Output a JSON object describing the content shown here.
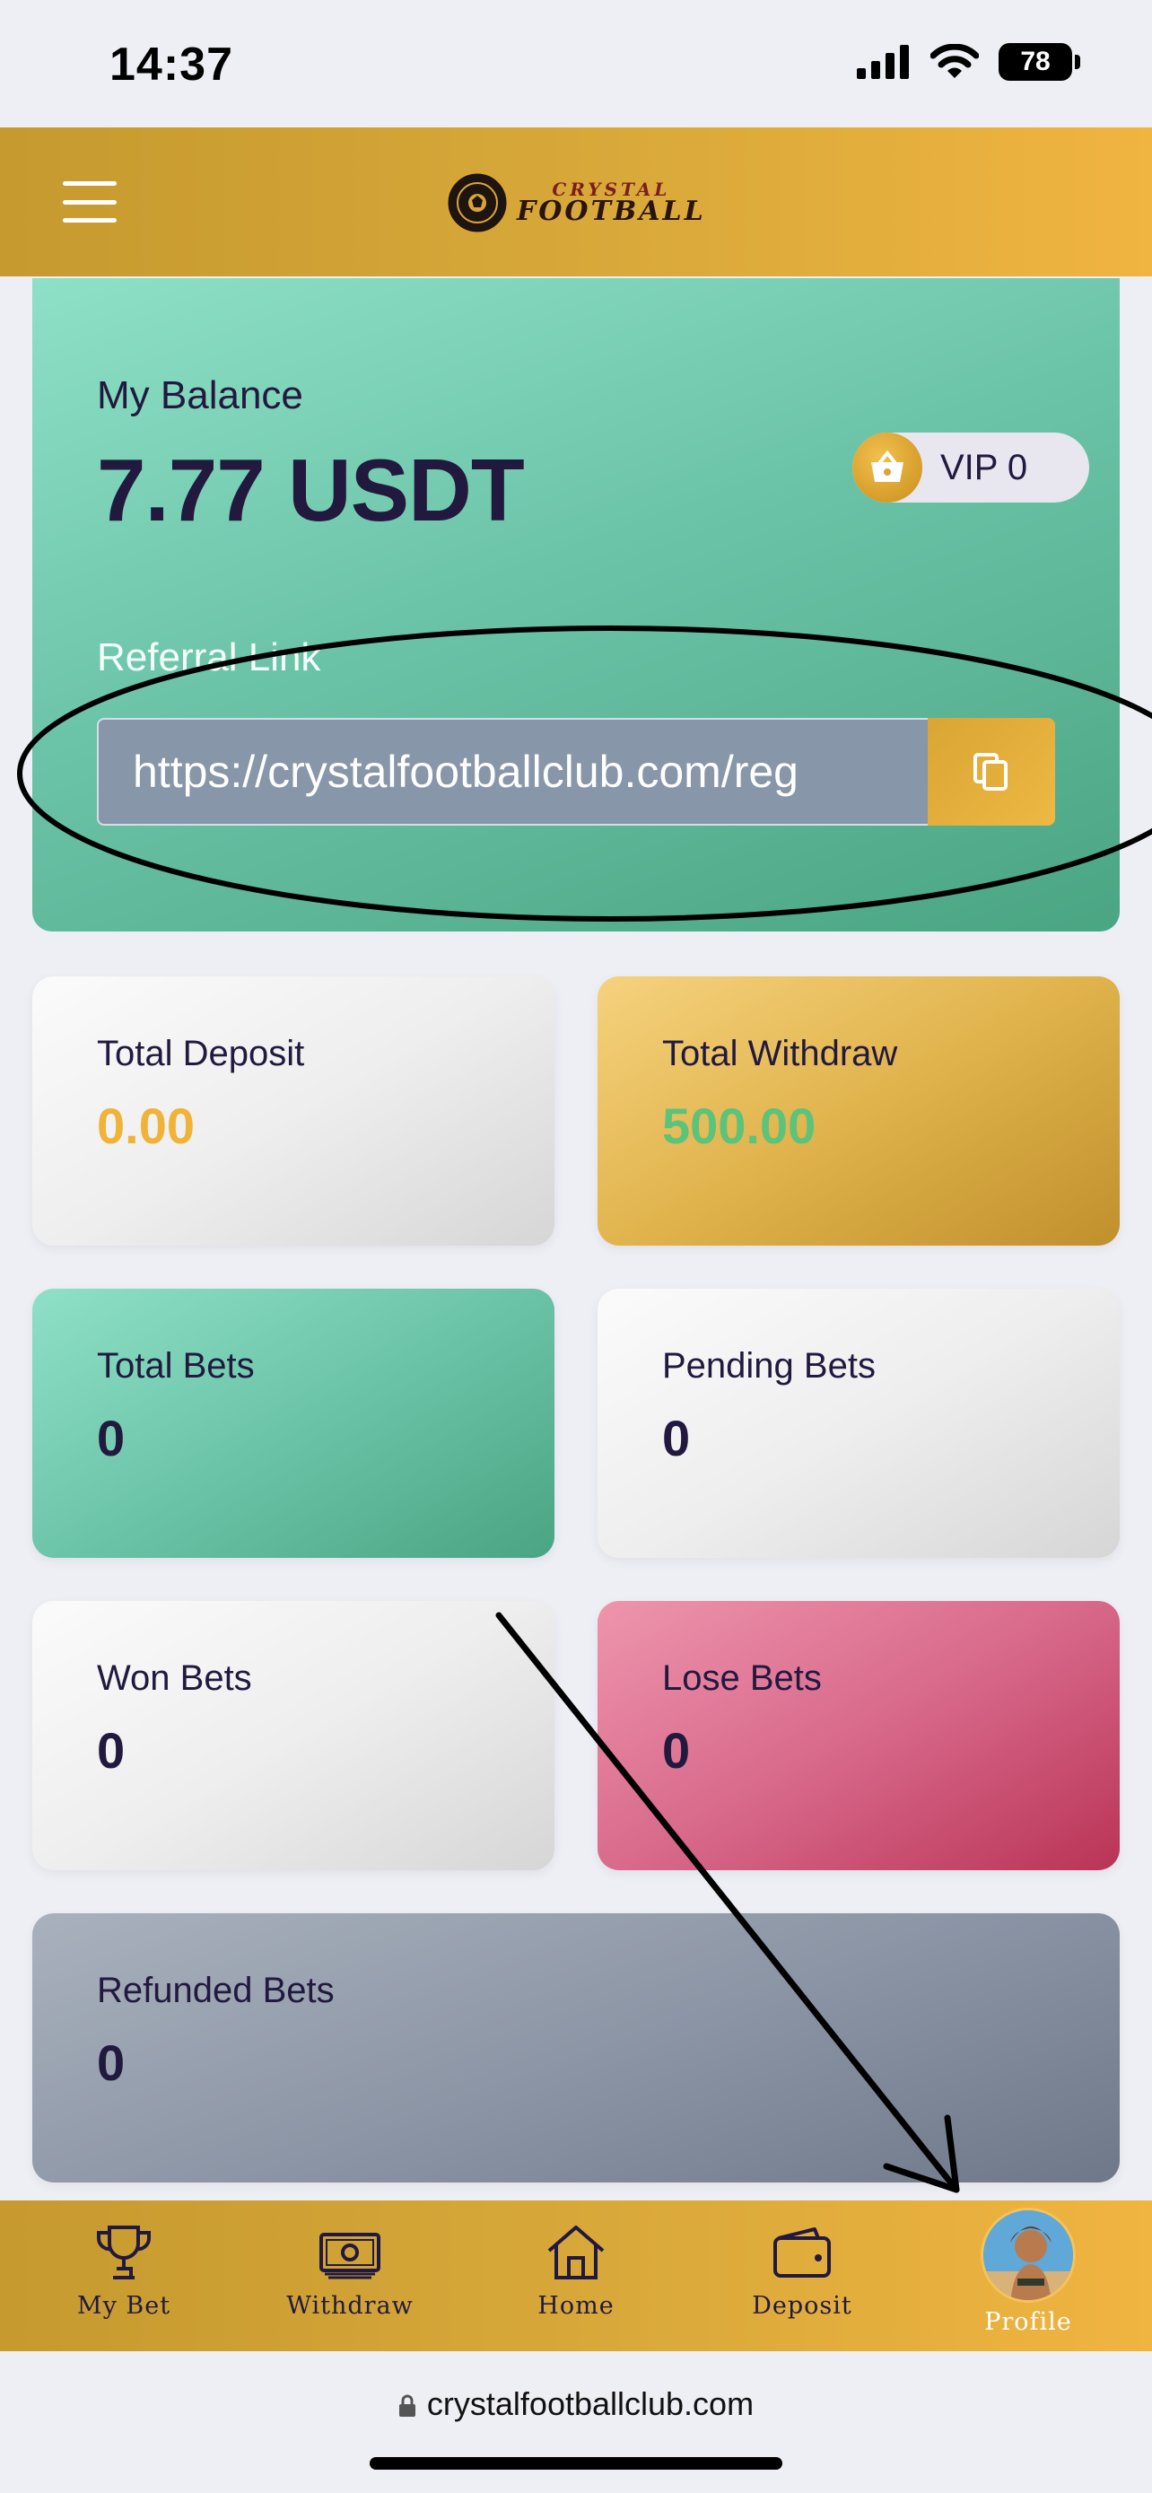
{
  "status_bar": {
    "time": "14:37",
    "battery": "78"
  },
  "header": {
    "logo_line1": "CRYSTAL",
    "logo_line2": "FOOTBALL"
  },
  "balance": {
    "label": "My Balance",
    "amount": "7.77 USDT",
    "vip": "VIP 0",
    "referral_label": "Referral Link",
    "referral_url": "https://crystalfootballclub.com/reg"
  },
  "stats": {
    "total_deposit": {
      "label": "Total Deposit",
      "value": "0.00"
    },
    "total_withdraw": {
      "label": "Total Withdraw",
      "value": "500.00"
    },
    "total_bets": {
      "label": "Total Bets",
      "value": "0"
    },
    "pending_bets": {
      "label": "Pending Bets",
      "value": "0"
    },
    "won_bets": {
      "label": "Won Bets",
      "value": "0"
    },
    "lose_bets": {
      "label": "Lose Bets",
      "value": "0"
    },
    "refunded_bets": {
      "label": "Refunded Bets",
      "value": "0"
    }
  },
  "colors": {
    "deposit_value": "#f0b33a",
    "withdraw_value": "#5cc37a",
    "accent_gold": "#e0a93a"
  },
  "nav": {
    "items": [
      {
        "label": "My Bet",
        "icon": "trophy-icon"
      },
      {
        "label": "Withdraw",
        "icon": "cash-icon"
      },
      {
        "label": "Home",
        "icon": "home-icon"
      },
      {
        "label": "Deposit",
        "icon": "wallet-icon"
      },
      {
        "label": "Profile",
        "icon": "avatar"
      }
    ]
  },
  "browser": {
    "url": "crystalfootballclub.com"
  }
}
